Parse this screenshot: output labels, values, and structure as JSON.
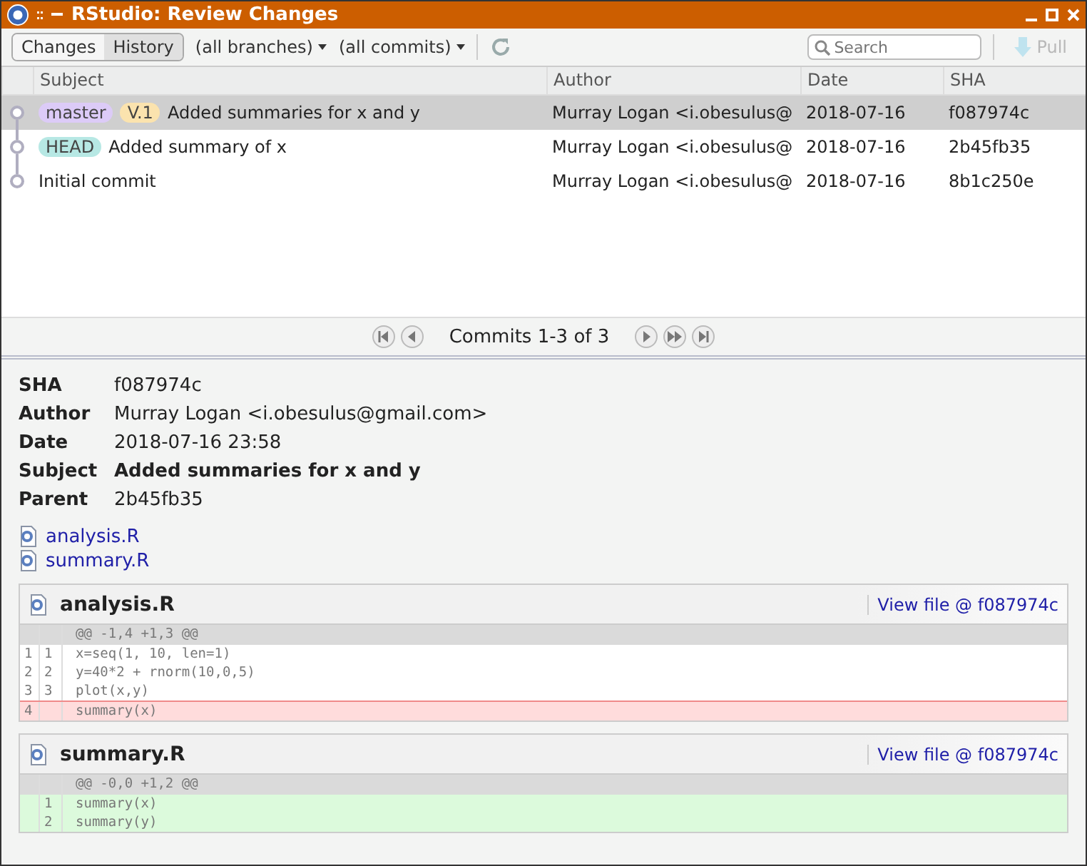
{
  "window": {
    "title": "RStudio: Review Changes"
  },
  "toolbar": {
    "tabs": [
      {
        "label": "Changes",
        "selected": false
      },
      {
        "label": "History",
        "selected": true
      }
    ],
    "branch_filter": "(all branches)",
    "commit_filter": "(all commits)",
    "search": {
      "placeholder": "Search"
    },
    "pull": {
      "label": "Pull",
      "disabled": true
    }
  },
  "table": {
    "columns": [
      "Subject",
      "Author",
      "Date",
      "SHA"
    ],
    "rows": [
      {
        "selected": true,
        "tags": [
          {
            "label": "master",
            "color": "#dccbf7"
          },
          {
            "label": "V.1",
            "color": "#fbe3ae"
          }
        ],
        "subject": "Added summaries for x and y",
        "author": "Murray Logan <i.obesulus@",
        "date": "2018-07-16",
        "sha": "f087974c"
      },
      {
        "selected": false,
        "tags": [
          {
            "label": "HEAD",
            "color": "#b7e8e4"
          }
        ],
        "subject": "Added summary of x",
        "author": "Murray Logan <i.obesulus@",
        "date": "2018-07-16",
        "sha": "2b45fb35"
      },
      {
        "selected": false,
        "tags": [],
        "subject": "Initial commit",
        "author": "Murray Logan <i.obesulus@",
        "date": "2018-07-16",
        "sha": "8b1c250e"
      }
    ]
  },
  "pager": {
    "label": "Commits 1-3 of 3"
  },
  "details": {
    "fields": [
      {
        "label": "SHA",
        "value": "f087974c",
        "emphasis": false
      },
      {
        "label": "Author",
        "value": "Murray Logan <i.obesulus@gmail.com>",
        "emphasis": false
      },
      {
        "label": "Date",
        "value": "2018-07-16 23:58",
        "emphasis": false
      },
      {
        "label": "Subject",
        "value": "Added summaries for x and y",
        "emphasis": true
      },
      {
        "label": "Parent",
        "value": "2b45fb35",
        "emphasis": false
      }
    ],
    "files": [
      "analysis.R",
      "summary.R"
    ],
    "diffs": [
      {
        "file": "analysis.R",
        "link": "View file @ f087974c",
        "lines": [
          {
            "kind": "hunk",
            "text": "@@ -1,4 +1,3 @@"
          },
          {
            "kind": "context",
            "old": "1",
            "new": "1",
            "text": "x=seq(1, 10, len=1)"
          },
          {
            "kind": "context",
            "old": "2",
            "new": "2",
            "text": "y=40*2 + rnorm(10,0,5)"
          },
          {
            "kind": "context",
            "old": "3",
            "new": "3",
            "text": "plot(x,y)"
          },
          {
            "kind": "removed",
            "old": "4",
            "text": "summary(x)"
          }
        ]
      },
      {
        "file": "summary.R",
        "link": "View file @ f087974c",
        "lines": [
          {
            "kind": "hunk",
            "text": "@@ -0,0 +1,2 @@"
          },
          {
            "kind": "added",
            "new": "1",
            "text": "summary(x)"
          },
          {
            "kind": "added",
            "new": "2",
            "text": "summary(y)"
          }
        ]
      }
    ]
  }
}
